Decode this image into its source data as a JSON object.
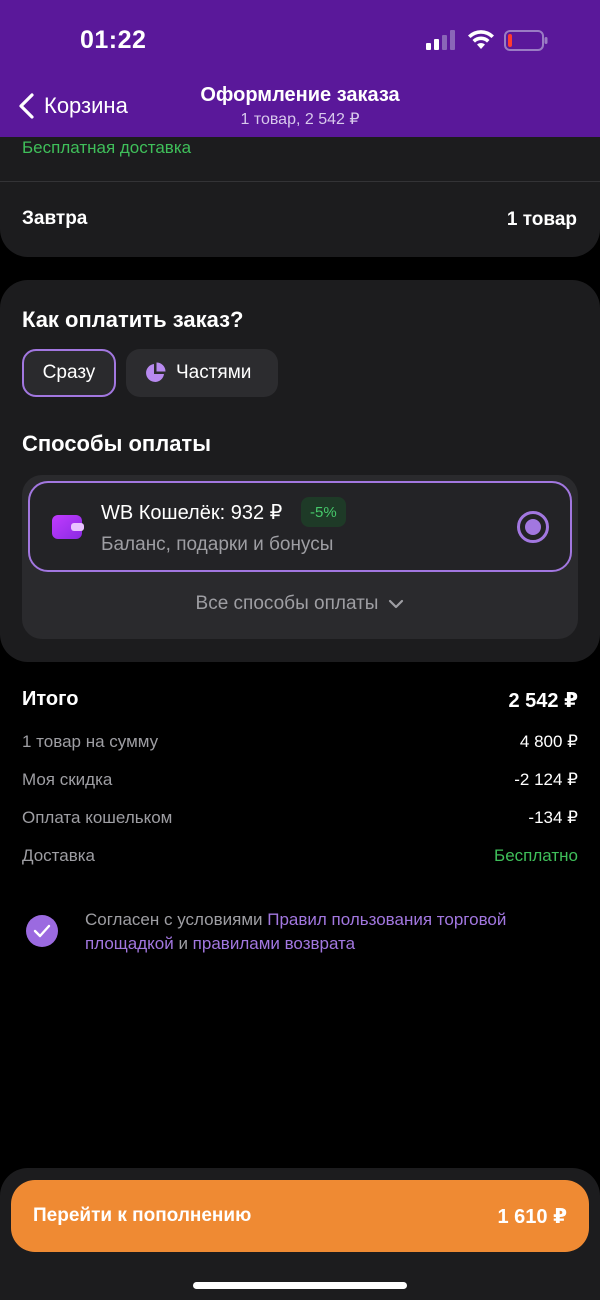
{
  "status_bar": {
    "time": "01:22"
  },
  "nav": {
    "back_label": "Корзина",
    "title": "Оформление заказа",
    "subtitle": "1 товар, 2 542 ₽"
  },
  "delivery": {
    "free_delivery": "Бесплатная доставка",
    "date": "Завтра",
    "items": "1 товар"
  },
  "payment": {
    "title": "Как оплатить заказ?",
    "mode_now": "Сразу",
    "mode_parts": "Частями",
    "methods_title": "Способы оплаты",
    "wb_wallet_label": "WB Кошелёк: 932 ₽",
    "wb_badge": "-5%",
    "wb_subtitle": "Баланс, подарки и бонусы",
    "all_methods": "Все способы оплаты"
  },
  "totals": {
    "total_label": "Итого",
    "total_value": "2 542 ₽",
    "rows": [
      {
        "label": "1 товар на сумму",
        "value": "4 800 ₽"
      },
      {
        "label": "Моя скидка",
        "value": "-2 124 ₽"
      },
      {
        "label": "Оплата кошельком",
        "value": "-134 ₽"
      },
      {
        "label": "Доставка",
        "value": "Бесплатно"
      }
    ]
  },
  "agreement": {
    "prefix": "Согласен с условиями ",
    "link_rules": "Правил пользования торговой площадкой",
    "middle": " и ",
    "link_returns": "правилами возврата"
  },
  "cta": {
    "label": "Перейти к пополнению",
    "amount": "1 610 ₽"
  },
  "colors": {
    "header_bg": "#5a189a",
    "accent_purple": "#a277e0",
    "green": "#3fbf5a",
    "cta_orange": "#ef8a33"
  }
}
